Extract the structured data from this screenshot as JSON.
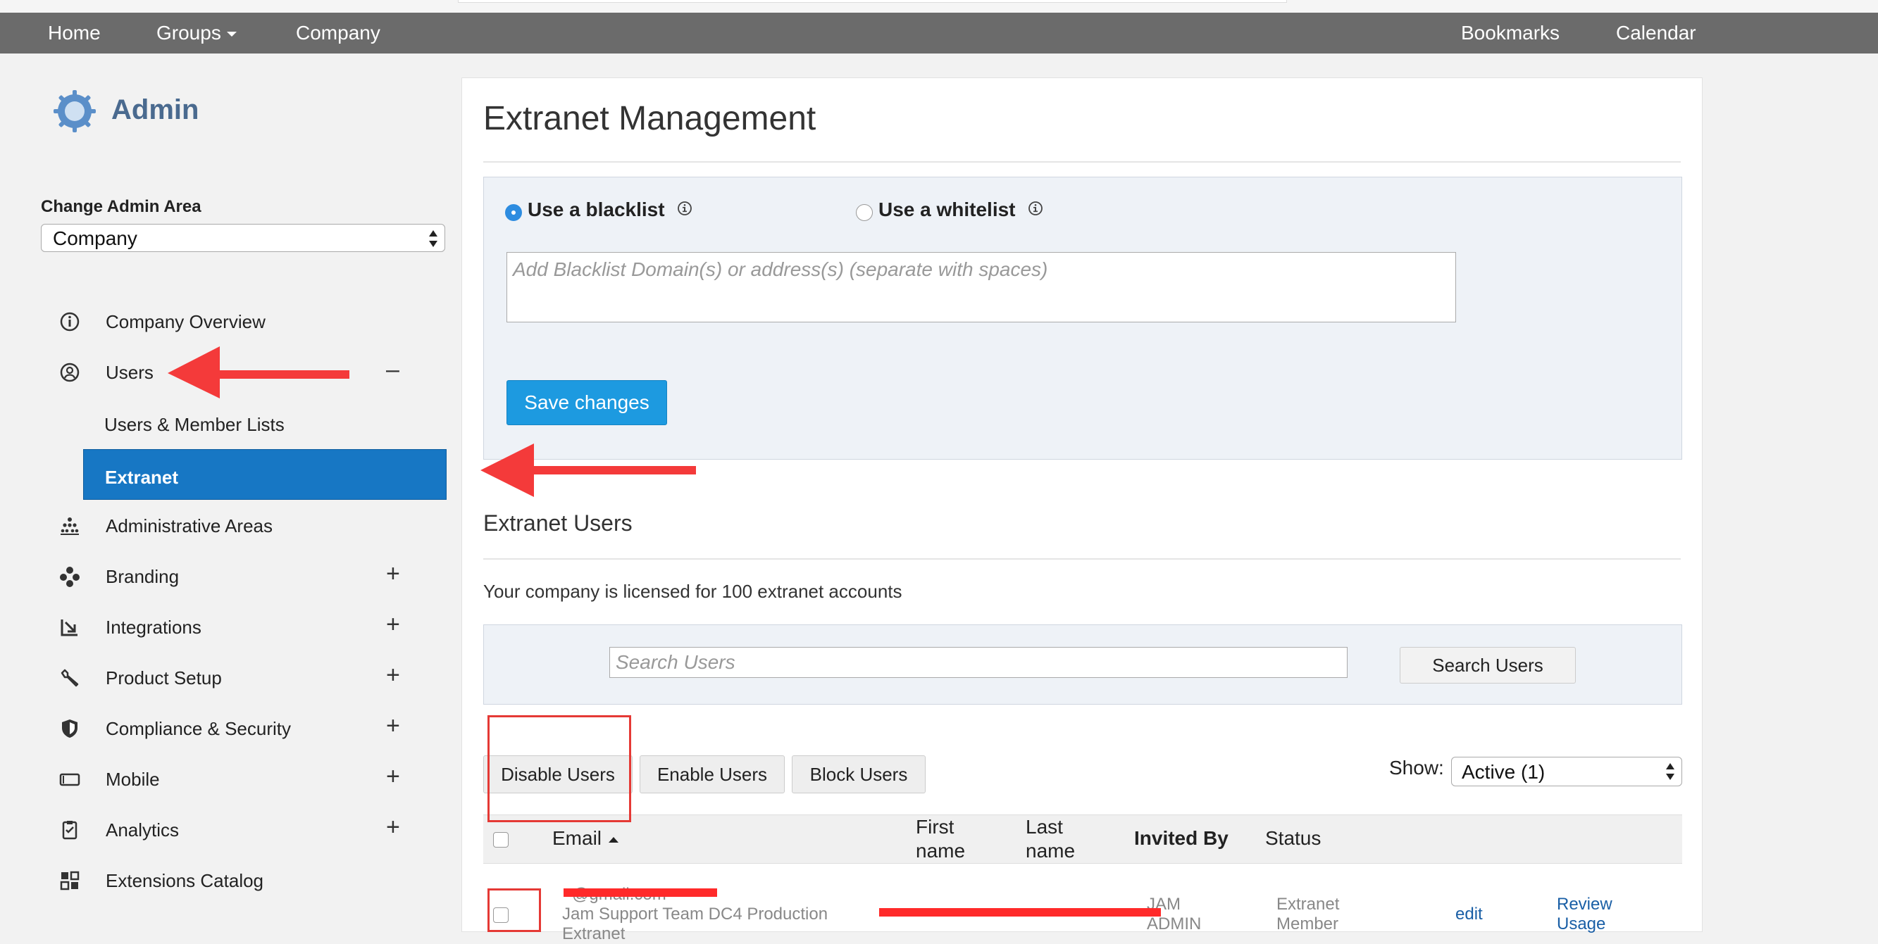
{
  "topnav": {
    "home": "Home",
    "groups": "Groups",
    "company": "Company",
    "bookmarks": "Bookmarks",
    "calendar": "Calendar"
  },
  "sidebar": {
    "title": "Admin",
    "change_area_label": "Change Admin Area",
    "area_selected": "Company",
    "items": [
      {
        "label": "Company Overview",
        "icon": "info-circle-icon",
        "toggle": ""
      },
      {
        "label": "Users",
        "icon": "user-circle-icon",
        "toggle": "–"
      },
      {
        "label": "Users & Member Lists",
        "sub": true
      },
      {
        "label": "Extranet",
        "sub": true,
        "active": true
      },
      {
        "label": "Administrative Areas",
        "icon": "org-chart-icon",
        "toggle": ""
      },
      {
        "label": "Branding",
        "icon": "palette-icon",
        "toggle": "+"
      },
      {
        "label": "Integrations",
        "icon": "arrow-in-box-icon",
        "toggle": "+"
      },
      {
        "label": "Product Setup",
        "icon": "wrench-icon",
        "toggle": "+"
      },
      {
        "label": "Compliance & Security",
        "icon": "shield-icon",
        "toggle": "+"
      },
      {
        "label": "Mobile",
        "icon": "mobile-icon",
        "toggle": "+"
      },
      {
        "label": "Analytics",
        "icon": "clipboard-icon",
        "toggle": "+"
      },
      {
        "label": "Extensions Catalog",
        "icon": "grid-icon",
        "toggle": ""
      }
    ]
  },
  "main": {
    "title": "Extranet Management",
    "blacklist_label": "Use a blacklist",
    "whitelist_label": "Use a whitelist",
    "domain_placeholder": "Add Blacklist Domain(s) or address(s) (separate with spaces)",
    "save_label": "Save changes",
    "users_section_title": "Extranet Users",
    "license_text": "Your company is licensed for 100 extranet accounts",
    "search_placeholder": "Search Users",
    "search_button": "Search Users",
    "disable_button": "Disable Users",
    "enable_button": "Enable Users",
    "block_button": "Block Users",
    "show_label": "Show:",
    "show_selected": "Active (1)"
  },
  "table": {
    "headers": {
      "email": "Email",
      "first_name": "First name",
      "last_name": "Last name",
      "invited_by": "Invited By",
      "status": "Status"
    },
    "rows": [
      {
        "email": "@gmail.com",
        "group": "Jam Support Team DC4 Production",
        "type": "Extranet",
        "invited_by": "JAM ADMIN",
        "status": "Extranet Member",
        "edit": "edit",
        "review": "Review Usage"
      }
    ]
  },
  "colors": {
    "topnav_bg": "#6b6b6b",
    "active_item_bg": "#1777c4",
    "primary_button": "#1d9ae0",
    "annotation_red": "#e53935"
  }
}
